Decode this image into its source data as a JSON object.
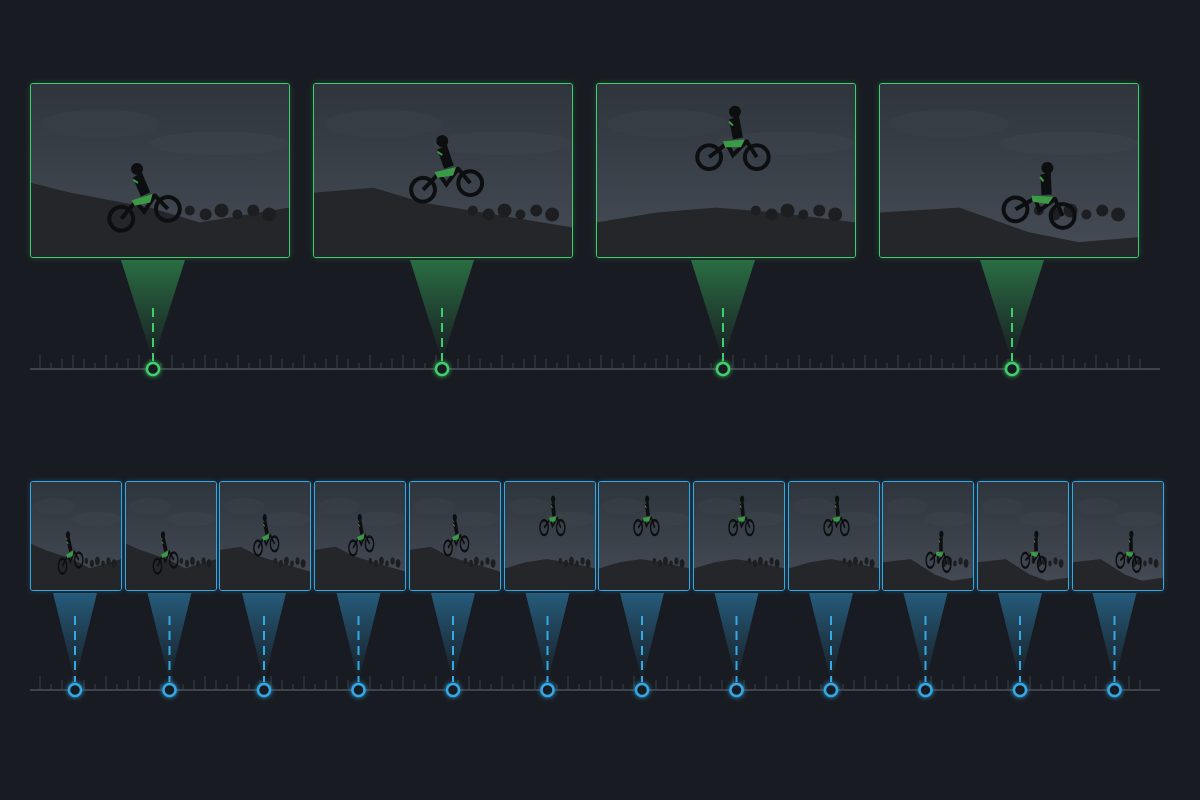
{
  "colors": {
    "background": "#181c22",
    "sparse_accent": "#3fcf6a",
    "dense_accent": "#35a8e6",
    "timeline": "#4a505a",
    "sky_top": "#2f353d",
    "sky_bottom": "#454c55",
    "ground": "#24262a",
    "rider": "#0c0e10",
    "bike_highlight": "#3b9a45"
  },
  "sparse_track": {
    "name": "sparse-keyframes",
    "accent": "#3fcf6a",
    "frames": [
      {
        "icon": "motocross-jump-frame",
        "pose": "launch"
      },
      {
        "icon": "motocross-jump-frame",
        "pose": "rising"
      },
      {
        "icon": "motocross-jump-frame",
        "pose": "peak"
      },
      {
        "icon": "motocross-jump-frame",
        "pose": "landing"
      }
    ]
  },
  "dense_track": {
    "name": "dense-keyframes",
    "accent": "#35a8e6",
    "frames": [
      {
        "icon": "motocross-jump-frame",
        "pose": "launch"
      },
      {
        "icon": "motocross-jump-frame",
        "pose": "launch"
      },
      {
        "icon": "motocross-jump-frame",
        "pose": "rising"
      },
      {
        "icon": "motocross-jump-frame",
        "pose": "rising"
      },
      {
        "icon": "motocross-jump-frame",
        "pose": "rising"
      },
      {
        "icon": "motocross-jump-frame",
        "pose": "peak"
      },
      {
        "icon": "motocross-jump-frame",
        "pose": "peak"
      },
      {
        "icon": "motocross-jump-frame",
        "pose": "peak"
      },
      {
        "icon": "motocross-jump-frame",
        "pose": "peak"
      },
      {
        "icon": "motocross-jump-frame",
        "pose": "landing"
      },
      {
        "icon": "motocross-jump-frame",
        "pose": "landing"
      },
      {
        "icon": "motocross-jump-frame",
        "pose": "landing"
      }
    ]
  }
}
